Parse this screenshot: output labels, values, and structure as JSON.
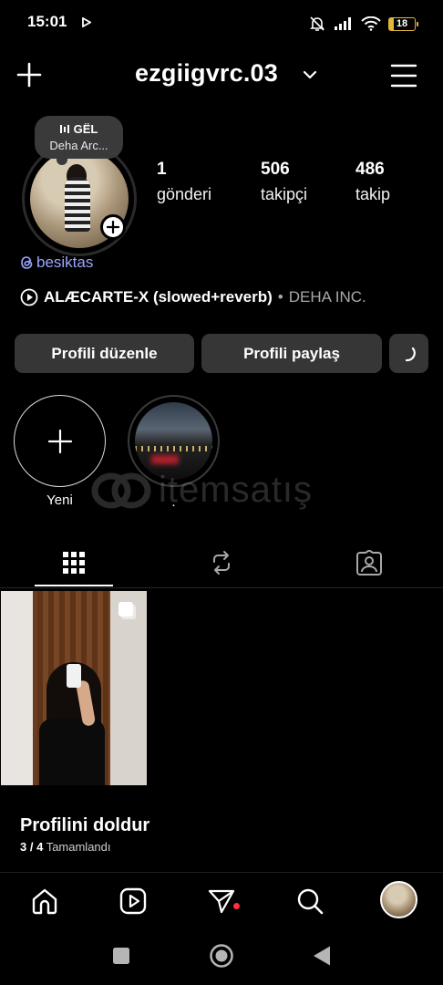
{
  "status_bar": {
    "time": "15:01",
    "battery": "18",
    "icons": [
      "play-icon",
      "bell-muted-icon",
      "signal-icon",
      "wifi-icon",
      "battery-icon"
    ]
  },
  "header": {
    "username": "ezgiigvrc.03"
  },
  "note": {
    "title": "GËL",
    "subtitle": "Deha Arc..."
  },
  "stats": [
    {
      "value": "1",
      "label": "gönderi"
    },
    {
      "value": "506",
      "label": "takipçi"
    },
    {
      "value": "486",
      "label": "takip"
    }
  ],
  "threads_handle": "besiktas",
  "music": {
    "title": "ALÆCARTE-X (slowed+reverb)",
    "separator": "•",
    "artist": "DEHA INC."
  },
  "buttons": {
    "edit_profile": "Profili düzenle",
    "share_profile": "Profili paylaş"
  },
  "highlights": [
    {
      "label": "Yeni"
    },
    {
      "label": "."
    }
  ],
  "watermark": "itemsatış",
  "profile_completion": {
    "title": "Profilini doldur",
    "progress": "3 / 4",
    "status": "Tamamlandı"
  },
  "colors": {
    "background": "#000000",
    "button": "#363636",
    "threads_link": "#9aa6ff",
    "notification_dot": "#ff3040",
    "battery": "#e2b53b"
  }
}
